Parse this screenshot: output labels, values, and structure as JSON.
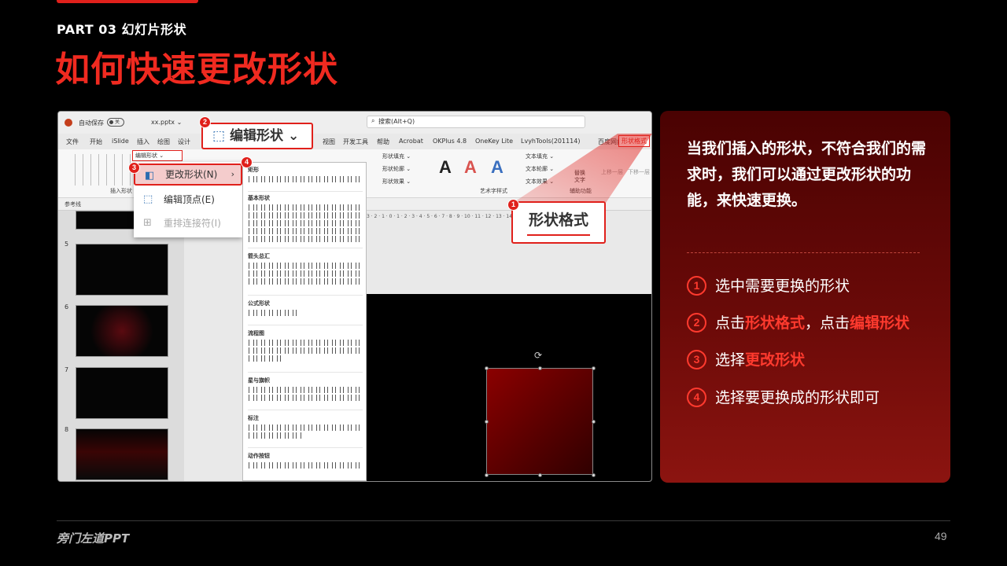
{
  "header": {
    "part_label": "PART 03  幻灯片形状",
    "title": "如何快速更改形状"
  },
  "screenshot": {
    "titlebar": {
      "autosave": "自动保存",
      "toggle": "关",
      "filename": "xx.pptx ⌄",
      "search_placeholder": "搜索(Alt+Q)"
    },
    "tabs": [
      "文件",
      "开始",
      "iSlide",
      "插入",
      "绘图",
      "设计",
      "视图",
      "开发工具",
      "帮助",
      "Acrobat",
      "OKPlus 4.8",
      "OneKey Lite",
      "LvyhTools(201114)",
      "百度网盘",
      "形状格式"
    ],
    "ribbon": {
      "edit_shape_small": "编辑形状 ⌄",
      "insert_shapes_label": "插入形状",
      "shape_fill": "形状填充 ⌄",
      "shape_outline": "形状轮廓 ⌄",
      "shape_effects": "形状效果 ⌄",
      "text_fill": "文本填充 ⌄",
      "text_outline": "文本轮廓 ⌄",
      "text_effects": "文本效果 ⌄",
      "art_label": "艺术字样式",
      "alt_text": "替换文字",
      "aux_label": "辅助功能",
      "bring_forward": "上移一层",
      "send_backward": "下移一层",
      "reference_line": "参考线",
      "letter_a": "A"
    },
    "slide_numbers": [
      "5",
      "6",
      "7",
      "8"
    ],
    "ruler": "3 · 2 · 1 · 0 · 1 · 2 · 3 · 4 · 5 · 6 · 7 · 8 · 9 · 10 · 11 · 12 · 13 · 14",
    "callouts": {
      "edit_shape": "编辑形状 ⌄",
      "shape_format": "形状格式"
    },
    "menu": {
      "change_shape": "更改形状(N)",
      "edit_points": "编辑顶点(E)",
      "reroute": "重排连接符(I)"
    },
    "shape_sections": [
      "矩形",
      "基本形状",
      "箭头总汇",
      "公式形状",
      "流程图",
      "星与旗帜",
      "标注",
      "动作按钮"
    ],
    "badges": [
      "1",
      "2",
      "3",
      "4"
    ]
  },
  "card": {
    "intro": "当我们插入的形状，不符合我们的需求时，我们可以通过更改形状的功能，来快速更换。",
    "steps": [
      {
        "num": "1",
        "pre": "选中需要更换的形状",
        "hl1": "",
        "mid": "",
        "hl2": ""
      },
      {
        "num": "2",
        "pre": "点击",
        "hl1": "形状格式",
        "mid": "，点击",
        "hl2": "编辑形状"
      },
      {
        "num": "3",
        "pre": "选择",
        "hl1": "更改形状",
        "mid": "",
        "hl2": ""
      },
      {
        "num": "4",
        "pre": "选择要更换成的形状即可",
        "hl1": "",
        "mid": "",
        "hl2": ""
      }
    ]
  },
  "footer": {
    "brand": "旁门左道PPT",
    "page": "49"
  },
  "colors": {
    "accent": "#e0201b",
    "highlight": "#ff3a2e",
    "card_bg": "#6a0a08"
  }
}
